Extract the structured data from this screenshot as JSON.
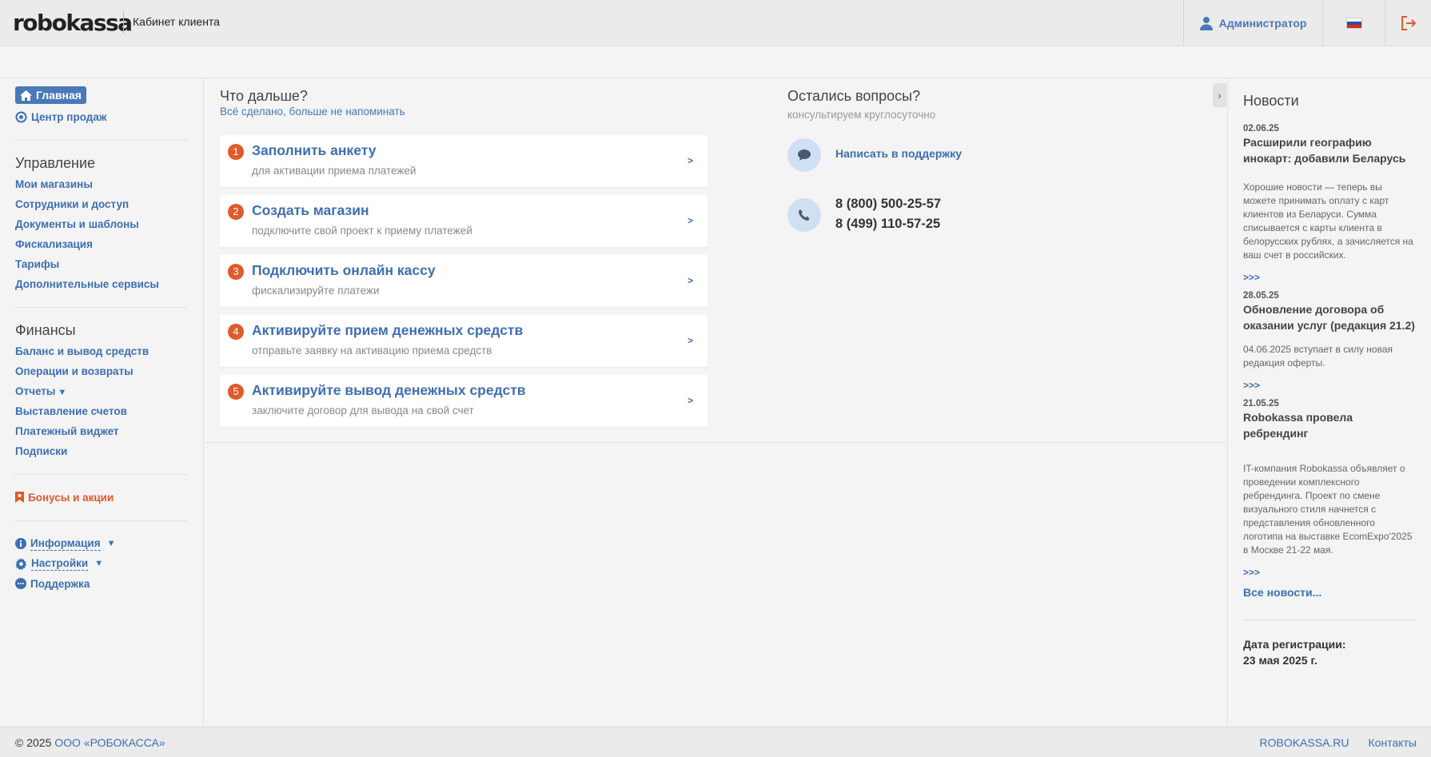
{
  "header": {
    "logo": "robokassa",
    "cabinet": "Кабинет клиента",
    "user": "Администратор"
  },
  "sidebar": {
    "home": "Главная",
    "sales_center": "Центр продаж",
    "management": {
      "heading": "Управление",
      "items": [
        "Мои магазины",
        "Сотрудники и доступ",
        "Документы и шаблоны",
        "Фискализация",
        "Тарифы",
        "Дополнительные сервисы"
      ]
    },
    "finance": {
      "heading": "Финансы",
      "items": [
        "Баланс и вывод средств",
        "Операции и возвраты",
        "Отчеты",
        "Выставление счетов",
        "Платежный виджет",
        "Подписки"
      ]
    },
    "bonus": "Бонусы и акции",
    "info": "Информация",
    "settings": "Настройки",
    "support": "Поддержка"
  },
  "main": {
    "next_title": "Что дальше?",
    "next_sub": "Всё сделано, больше не напоминать",
    "steps": [
      {
        "num": "1",
        "title": "Заполнить анкету",
        "sub": "для активации приема платежей"
      },
      {
        "num": "2",
        "title": "Создать магазин",
        "sub": "подключите свой проект к приему платежей"
      },
      {
        "num": "3",
        "title": "Подключить онлайн кассу",
        "sub": "фискализируйте платежи"
      },
      {
        "num": "4",
        "title": "Активируйте прием денежных средств",
        "sub": "отправьте заявку на активацию приема средств"
      },
      {
        "num": "5",
        "title": "Активируйте вывод денежных средств",
        "sub": "заключите договор для вывода на свой счет"
      }
    ],
    "arrow": ">",
    "questions_title": "Остались вопросы?",
    "questions_sub": "консультируем круглосуточно",
    "support_link": "Написать в поддержку",
    "phone1": "8 (800) 500-25-57",
    "phone2": "8 (499) 110-57-25"
  },
  "news": {
    "heading": "Новости",
    "items": [
      {
        "date": "02.06.25",
        "title": "Расширили географию инокарт: добавили Беларусь",
        "body": "Хорошие новости — теперь вы можете принимать оплату с карт клиентов из Беларуси. Сумма списывается с карты клиента в белорусских рублях, а зачисляется на ваш счет в российских."
      },
      {
        "date": "28.05.25",
        "title": "Обновление договора об оказании услуг (редакция 21.2)",
        "body": "04.06.2025 вступает в силу новая редакция оферты."
      },
      {
        "date": "21.05.25",
        "title": "Robokassa провела ребрендинг",
        "body": "IT-компания Robokassa объявляет о проведении комплексного ребрендинга. Проект по смене визуального стиля начнется с представления обновленного логотипа на выставке EcomExpo'2025 в Москве 21-22 мая."
      }
    ],
    "more": ">>>",
    "all": "Все новости...",
    "reg_label": "Дата регистрации:",
    "reg_date": "23 мая 2025 г."
  },
  "footer": {
    "copyright": "© 2025",
    "company": "ООО «РОБОКАССА»",
    "site": "ROBOKASSA.RU",
    "contacts": "Контакты"
  },
  "colors": {
    "accent": "#3d6fb2",
    "orange": "#e05a2b"
  }
}
